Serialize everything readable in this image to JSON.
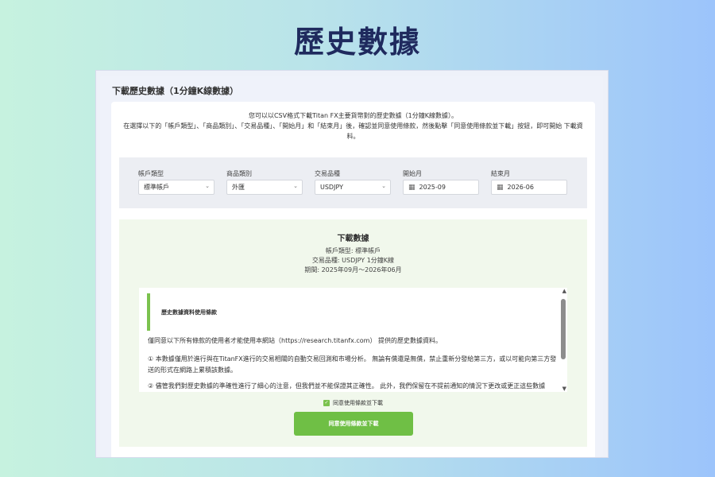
{
  "hero": {
    "title": "歷史數據"
  },
  "section": {
    "title": "下載歷史數據（1分鐘K線數據）"
  },
  "intro": {
    "line1": "您可以以CSV格式下載Titan FX主要貨幣對的歷史數據（1分鐘K線數據）。",
    "line2": "在選擇以下的「帳戶類型」、「商品類別」、「交易品種」、「開始月」和「結束月」後，確認並同意使用條款，然後點擊「同意使用條款並下載」按鈕，即可開始 下載資料。"
  },
  "filters": {
    "account_type": {
      "label": "帳戶類型",
      "value": "標準帳戶"
    },
    "product_category": {
      "label": "商品類別",
      "value": "外匯"
    },
    "symbol": {
      "label": "交易品種",
      "value": "USDJPY"
    },
    "start_month": {
      "label": "開始月",
      "value": "2025-09"
    },
    "end_month": {
      "label": "結束月",
      "value": "2026-06"
    }
  },
  "download": {
    "title": "下載數據",
    "account_line": "帳戶類型: 標準帳戶",
    "symbol_line": "交易品種: USDJPY 1分鐘K線",
    "period_line": "期間: 2025年09月～2026年06月",
    "terms": {
      "heading": "歷史數據資料使用條款",
      "para1": "僅同意以下所有條款的使用者才能使用本網站（https://research.titanfx.com） 提供的歷史數據資料。",
      "para2": "① 本數據僅用於進行與在TitanFX進行的交易相關的自動交易回測和市場分析。 無論有償還是無償，禁止重新分發給第三方，或以可能向第三方發送的形式在網路上累積該數據。",
      "para3": "② 儘管我們對歷史數據的準確性進行了細心的注意，但我們並不能保證其正確性。 此外，我們保留在不提前通知的情況下更改或更正這些數據"
    },
    "agree_label": "同意使用條款並下載",
    "button_label": "同意使用條款並下載"
  },
  "colors": {
    "accent_green": "#6fbf45",
    "title_navy": "#1f2a5e"
  }
}
